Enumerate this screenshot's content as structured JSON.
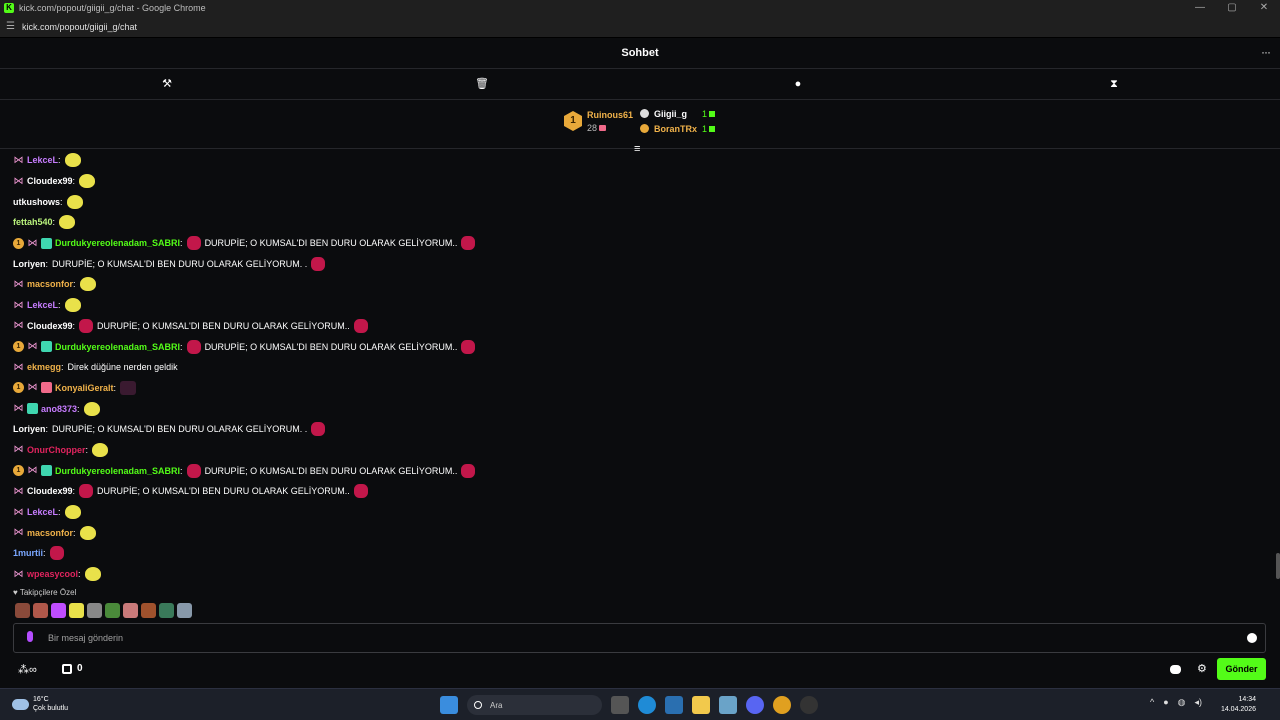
{
  "window": {
    "title": "kick.com/popout/giigii_g/chat - Google Chrome",
    "url": "kick.com/popout/giigii_g/chat"
  },
  "window_controls": [
    "—",
    "▢",
    "✕"
  ],
  "header": {
    "title": "Sohbet",
    "more": "···"
  },
  "toolbar": {
    "icons": [
      "hammer-icon",
      "trash-icon",
      "chat-bubble-icon",
      "hourglass-icon"
    ]
  },
  "leaderboard": {
    "top": {
      "rank": "1",
      "name": "Ruinous61",
      "count": "28"
    },
    "others": [
      {
        "name": "Giigii_g",
        "count": "1"
      },
      {
        "name": "BoranTRx",
        "count": "1"
      }
    ]
  },
  "messages": [
    {
      "user": "LekceL",
      "color": "#c77dff",
      "badges": [
        "sub"
      ],
      "text": "",
      "emotes": [
        "yellow"
      ]
    },
    {
      "user": "Cloudex99",
      "color": "#ffffff",
      "badges": [
        "sub"
      ],
      "text": "",
      "emotes": [
        "yellow"
      ]
    },
    {
      "user": "utkushows",
      "color": "#ffffff",
      "badges": [],
      "text": "",
      "emotes": [
        "yellow"
      ]
    },
    {
      "user": "fettah540",
      "color": "#b9f27c",
      "badges": [],
      "text": "",
      "emotes": [
        "yellow"
      ]
    },
    {
      "user": "Durdukyereolenadam_SABRI",
      "color": "#53fc18",
      "badges": [
        "gift1",
        "sub",
        "gift2"
      ],
      "text": "DURUPİE; O KUMSAL'DI BEN DURU OLARAK GELİYORUM..",
      "emotes": [
        "red"
      ],
      "trailing": [
        "red"
      ]
    },
    {
      "user": "Loriyen",
      "color": "#ffffff",
      "badges": [],
      "text": "DURUPİE; O KUMSAL'DI BEN DURU OLARAK GELİYORUM. .",
      "emotes": [],
      "trailing": [
        "red"
      ]
    },
    {
      "user": "macsonfor",
      "color": "#f0b24a",
      "badges": [
        "sub"
      ],
      "text": "",
      "emotes": [
        "yellow"
      ]
    },
    {
      "user": "LekceL",
      "color": "#c77dff",
      "badges": [
        "sub"
      ],
      "text": "",
      "emotes": [
        "yellow"
      ]
    },
    {
      "user": "Cloudex99",
      "color": "#ffffff",
      "badges": [
        "sub"
      ],
      "text": "DURUPİE; O KUMSAL'DI BEN DURU OLARAK GELİYORUM..",
      "emotes": [
        "red"
      ],
      "trailing": [
        "red"
      ]
    },
    {
      "user": "Durdukyereolenadam_SABRI",
      "color": "#53fc18",
      "badges": [
        "gift1",
        "sub",
        "gift2"
      ],
      "text": "DURUPİE; O KUMSAL'DI BEN DURU OLARAK GELİYORUM..",
      "emotes": [
        "red"
      ],
      "trailing": [
        "red"
      ]
    },
    {
      "user": "ekmegg",
      "color": "#f0b24a",
      "badges": [
        "sub"
      ],
      "text": "Direk düğüne nerden geldik",
      "emotes": []
    },
    {
      "user": "KonyaliGeralt",
      "color": "#f0b24a",
      "badges": [
        "gift1",
        "sub",
        "gift3"
      ],
      "text": "",
      "emotes": [
        "dark"
      ]
    },
    {
      "user": "ano8373",
      "color": "#c77dff",
      "badges": [
        "sub",
        "gift2"
      ],
      "text": "",
      "emotes": [
        "yellow"
      ]
    },
    {
      "user": "Loriyen",
      "color": "#ffffff",
      "badges": [],
      "text": "DURUPİE; O KUMSAL'DI BEN DURU OLARAK GELİYORUM. .",
      "emotes": [],
      "trailing": [
        "red"
      ]
    },
    {
      "user": "OnurChopper",
      "color": "#e0245e",
      "badges": [
        "sub"
      ],
      "text": "",
      "emotes": [
        "yellow"
      ]
    },
    {
      "user": "Durdukyereolenadam_SABRI",
      "color": "#53fc18",
      "badges": [
        "gift1",
        "sub",
        "gift2"
      ],
      "text": "DURUPİE; O KUMSAL'DI BEN DURU OLARAK GELİYORUM..",
      "emotes": [
        "red"
      ],
      "trailing": [
        "red"
      ]
    },
    {
      "user": "Cloudex99",
      "color": "#ffffff",
      "badges": [
        "sub"
      ],
      "text": "DURUPİE; O KUMSAL'DI BEN DURU OLARAK GELİYORUM..",
      "emotes": [
        "red"
      ],
      "trailing": [
        "red"
      ]
    },
    {
      "user": "LekceL",
      "color": "#c77dff",
      "badges": [
        "sub"
      ],
      "text": "",
      "emotes": [
        "yellow"
      ]
    },
    {
      "user": "macsonfor",
      "color": "#f0b24a",
      "badges": [
        "sub"
      ],
      "text": "",
      "emotes": [
        "yellow"
      ]
    },
    {
      "user": "1murtii",
      "color": "#7aa7ff",
      "badges": [],
      "text": "",
      "emotes": [
        "red"
      ]
    },
    {
      "user": "wpeasycool",
      "color": "#e0245e",
      "badges": [
        "sub"
      ],
      "text": "",
      "emotes": [
        "yellow"
      ]
    }
  ],
  "followers": {
    "label": "Takipçilere Özel",
    "emote_colors": [
      "#8a4a3a",
      "#b0584a",
      "#c04dff",
      "#e9e14a",
      "#888888",
      "#4a8a3a",
      "#c97a7a",
      "#a0522d",
      "#3a7a5a",
      "#8899aa"
    ]
  },
  "input": {
    "placeholder": "Bir mesaj gönderin"
  },
  "bottom": {
    "count": "0",
    "send_label": "Gönder"
  },
  "colors": {
    "accent": "#53fc18",
    "background": "#0b0c0e"
  },
  "taskbar": {
    "weather_temp": "16°C",
    "weather_desc": "Çok bulutlu",
    "search": "Ara",
    "time": "14:34",
    "date": "14.04.2026"
  }
}
